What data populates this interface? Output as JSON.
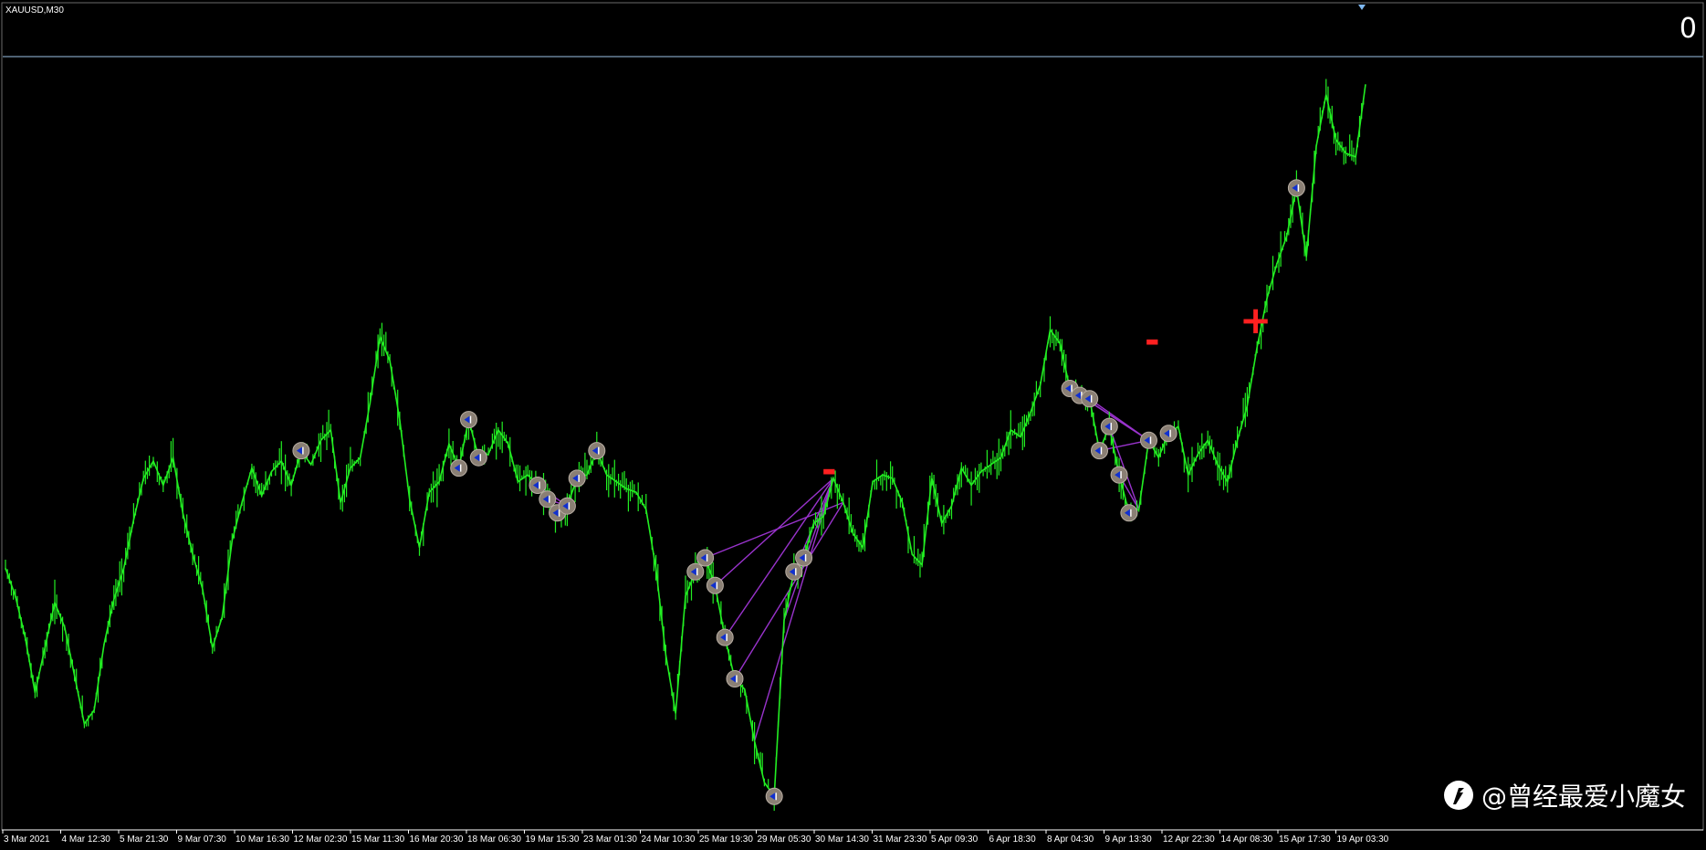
{
  "window": {
    "symbol": "XAUUSD,M30"
  },
  "profit_readout": "0",
  "markers": {
    "minus": "-",
    "plus": "+"
  },
  "watermark": {
    "text": "@曾经最爱小魔女"
  },
  "colors": {
    "background": "#000000",
    "price_line": "#22ee22",
    "trade_line": "#9933cc",
    "marker": "#ff2020",
    "order_circle": "#8a7f74",
    "axis": "#ffffff"
  },
  "chart_data": {
    "type": "line",
    "series": [
      {
        "values": [
          1712,
          1704,
          1692,
          1676,
          1689,
          1702,
          1695,
          1681,
          1667,
          1671,
          1690,
          1703,
          1712,
          1726,
          1738,
          1743,
          1736,
          1744,
          1728,
          1716,
          1706,
          1689,
          1698,
          1720,
          1731,
          1741,
          1733,
          1740,
          1743,
          1736,
          1746,
          1742,
          1749,
          1752,
          1731,
          1741,
          1744,
          1760,
          1779,
          1772,
          1755,
          1732,
          1718,
          1734,
          1737,
          1748,
          1741,
          1755,
          1744,
          1745,
          1752,
          1748,
          1737,
          1739,
          1736,
          1732,
          1728,
          1730,
          1738,
          1739,
          1746,
          1739,
          1737,
          1735,
          1734,
          1729,
          1712,
          1687,
          1670,
          1704,
          1711,
          1715,
          1707,
          1692,
          1680,
          1677,
          1662,
          1650,
          1646,
          1697,
          1711,
          1715,
          1725,
          1727,
          1738,
          1731,
          1722,
          1718,
          1737,
          1739,
          1738,
          1731,
          1716,
          1713,
          1738,
          1725,
          1730,
          1741,
          1736,
          1740,
          1742,
          1744,
          1752,
          1750,
          1757,
          1765,
          1781,
          1777,
          1764,
          1762,
          1761,
          1746,
          1753,
          1739,
          1728,
          1729,
          1749,
          1744,
          1751,
          1753,
          1739,
          1745,
          1749,
          1742,
          1737,
          1749,
          1759,
          1776,
          1790,
          1800,
          1808,
          1822,
          1802,
          1834,
          1849,
          1836,
          1832,
          1831,
          1852
        ]
      }
    ],
    "x_tick_labels": [
      "3 Mar 2021",
      "4 Mar 12:30",
      "5 Mar 21:30",
      "9 Mar 07:30",
      "10 Mar 16:30",
      "12 Mar 02:30",
      "15 Mar 11:30",
      "16 Mar 20:30",
      "18 Mar 06:30",
      "19 Mar 15:30",
      "23 Mar 01:30",
      "24 Mar 10:30",
      "25 Mar 19:30",
      "29 Mar 05:30",
      "30 Mar 14:30",
      "31 Mar 23:30",
      "5 Apr 09:30",
      "6 Apr 18:30",
      "8 Apr 04:30",
      "9 Apr 13:30",
      "12 Apr 22:30",
      "14 Apr 08:30",
      "15 Apr 17:30",
      "19 Apr 03:30"
    ],
    "ylim": [
      1640,
      1860
    ],
    "legend": "none",
    "grid": false,
    "title": "",
    "xlabel": "",
    "ylabel": ""
  },
  "trade_links": [
    {
      "from": 74,
      "to": 85
    },
    {
      "from": 71,
      "to": 85
    },
    {
      "from": 72,
      "to": 84
    },
    {
      "from": 73,
      "to": 84
    },
    {
      "from": 76,
      "to": 84
    },
    {
      "from": 79,
      "to": 84
    },
    {
      "from": 80,
      "to": 84
    },
    {
      "from": 54,
      "to": 57
    },
    {
      "from": 55,
      "to": 57
    },
    {
      "from": 56,
      "to": 57
    },
    {
      "from": 108,
      "to": 116
    },
    {
      "from": 109,
      "to": 116
    },
    {
      "from": 110,
      "to": 116
    },
    {
      "from": 111,
      "to": 116
    },
    {
      "from": 112,
      "to": 115
    },
    {
      "from": 113,
      "to": 115
    }
  ],
  "order_circles": [
    30,
    46,
    47,
    48,
    54,
    55,
    56,
    57,
    58,
    60,
    70,
    71,
    72,
    73,
    74,
    78,
    80,
    81,
    108,
    109,
    110,
    111,
    112,
    113,
    114,
    116,
    118,
    131
  ]
}
